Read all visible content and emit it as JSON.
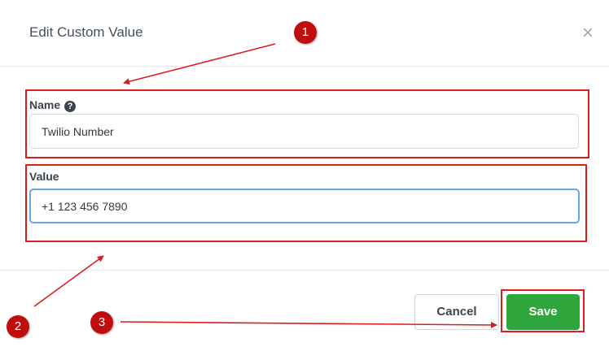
{
  "dialog": {
    "title": "Edit Custom Value",
    "close_symbol": "×"
  },
  "fields": {
    "name": {
      "label": "Name",
      "help_symbol": "?",
      "value": "Twilio Number"
    },
    "value": {
      "label": "Value",
      "value": "+1 123 456 7890"
    }
  },
  "buttons": {
    "cancel": "Cancel",
    "save": "Save"
  },
  "annotations": {
    "markers": [
      "1",
      "2",
      "3"
    ],
    "color": "#d91e1e"
  },
  "colors": {
    "save_green": "#2ea63c",
    "focus_blue": "#63a7e4",
    "marker_red": "#c00d0d"
  }
}
